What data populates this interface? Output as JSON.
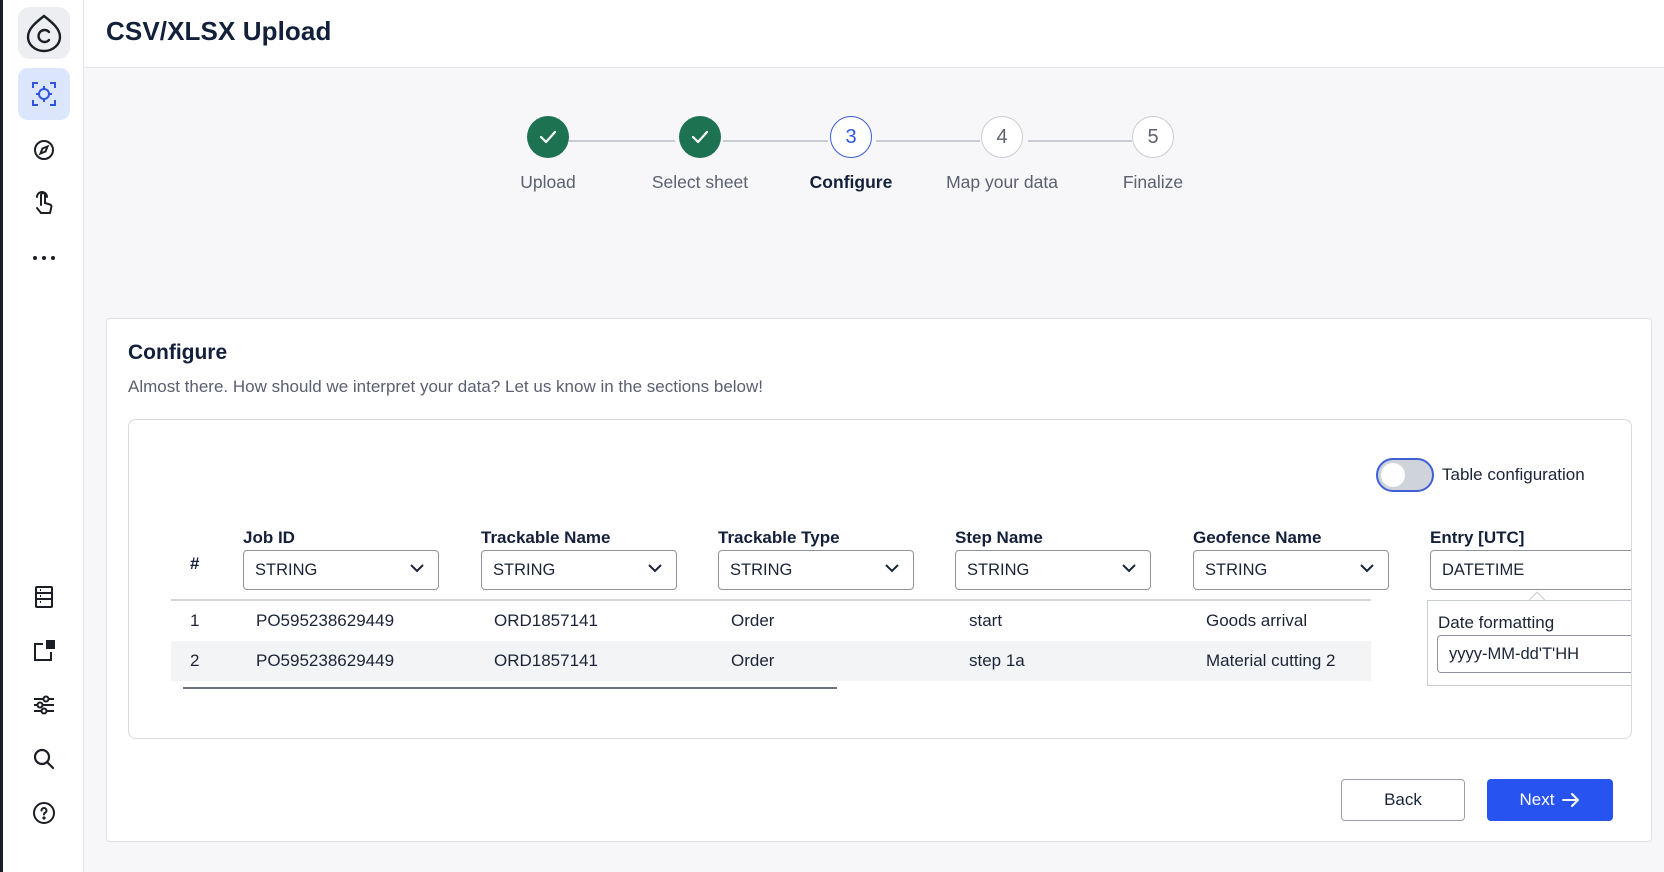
{
  "page": {
    "title": "CSV/XLSX Upload"
  },
  "sidebar": {
    "icons": [
      "logo-c-icon",
      "scan-icon",
      "compass-icon",
      "pointer-hand-icon",
      "more-icon",
      "list-icon",
      "add-widget-icon",
      "sliders-icon",
      "search-icon",
      "help-icon"
    ],
    "active": "scan-icon"
  },
  "stepper": {
    "steps": [
      {
        "number": "1",
        "label": "Upload",
        "state": "done"
      },
      {
        "number": "2",
        "label": "Select sheet",
        "state": "done"
      },
      {
        "number": "3",
        "label": "Configure",
        "state": "current"
      },
      {
        "number": "4",
        "label": "Map your data",
        "state": "todo"
      },
      {
        "number": "5",
        "label": "Finalize",
        "state": "todo"
      }
    ]
  },
  "configure": {
    "title": "Configure",
    "description": "Almost there. How should we interpret your data? Let us know in the sections below!",
    "toggle": {
      "label": "Table configuration",
      "on": false
    },
    "table": {
      "index_header": "#",
      "columns": [
        {
          "name": "Job ID",
          "type": "STRING"
        },
        {
          "name": "Trackable Name",
          "type": "STRING"
        },
        {
          "name": "Trackable Type",
          "type": "STRING"
        },
        {
          "name": "Step Name",
          "type": "STRING"
        },
        {
          "name": "Geofence Name",
          "type": "STRING"
        },
        {
          "name": "Entry [UTC]",
          "type": "DATETIME"
        }
      ],
      "rows": [
        {
          "index": "1",
          "cells": [
            "PO595238629449",
            "ORD1857141",
            "Order",
            "start",
            "Goods arrival"
          ]
        },
        {
          "index": "2",
          "cells": [
            "PO595238629449",
            "ORD1857141",
            "Order",
            "step 1a",
            "Material cutting 2"
          ]
        }
      ]
    },
    "date_formatting": {
      "label": "Date formatting",
      "value": "yyyy-MM-dd'T'HH"
    }
  },
  "actions": {
    "back_label": "Back",
    "next_label": "Next"
  },
  "colors": {
    "primary": "#2754f1",
    "done": "#1c7251",
    "title": "#13203b"
  }
}
